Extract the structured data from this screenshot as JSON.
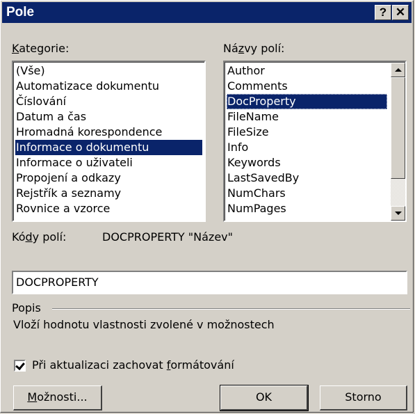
{
  "dialog": {
    "title": "Pole",
    "help_glyph": "?",
    "close_glyph": "✕"
  },
  "categories": {
    "label_prefix": "",
    "label_access": "K",
    "label_rest": "ategorie:",
    "items": [
      "(Vše)",
      "Automatizace dokumentu",
      "Číslování",
      "Datum a čas",
      "Hromadná korespondence",
      "Informace o dokumentu",
      "Informace o uživateli",
      "Propojení a odkazy",
      "Rejstřík a seznamy",
      "Rovnice a vzorce"
    ],
    "selected": "Informace o dokumentu"
  },
  "field_names": {
    "label_prefix": "Ná",
    "label_access": "z",
    "label_rest": "vy polí:",
    "items": [
      "Author",
      "Comments",
      "DocProperty",
      "FileName",
      "FileSize",
      "Info",
      "Keywords",
      "LastSavedBy",
      "NumChars",
      "NumPages"
    ],
    "selected": "DocProperty"
  },
  "field_codes": {
    "label_prefix": "Kó",
    "label_access": "d",
    "label_rest": "y polí:",
    "syntax": "DOCPROPERTY \"Název\"",
    "input_value": "DOCPROPERTY"
  },
  "description": {
    "group_label": "Popis",
    "text": "Vloží hodnotu vlastnosti zvolené v možnostech"
  },
  "preserve_formatting": {
    "checked": true,
    "label_prefix": "Při aktualizaci zachovat ",
    "label_access": "f",
    "label_rest": "ormátování"
  },
  "buttons": {
    "options_access": "M",
    "options_rest": "ožnosti...",
    "ok": "OK",
    "cancel": "Storno"
  },
  "colors": {
    "title_bar": "#0a246a",
    "selection": "#0a246a",
    "face": "#d4d0c8"
  }
}
